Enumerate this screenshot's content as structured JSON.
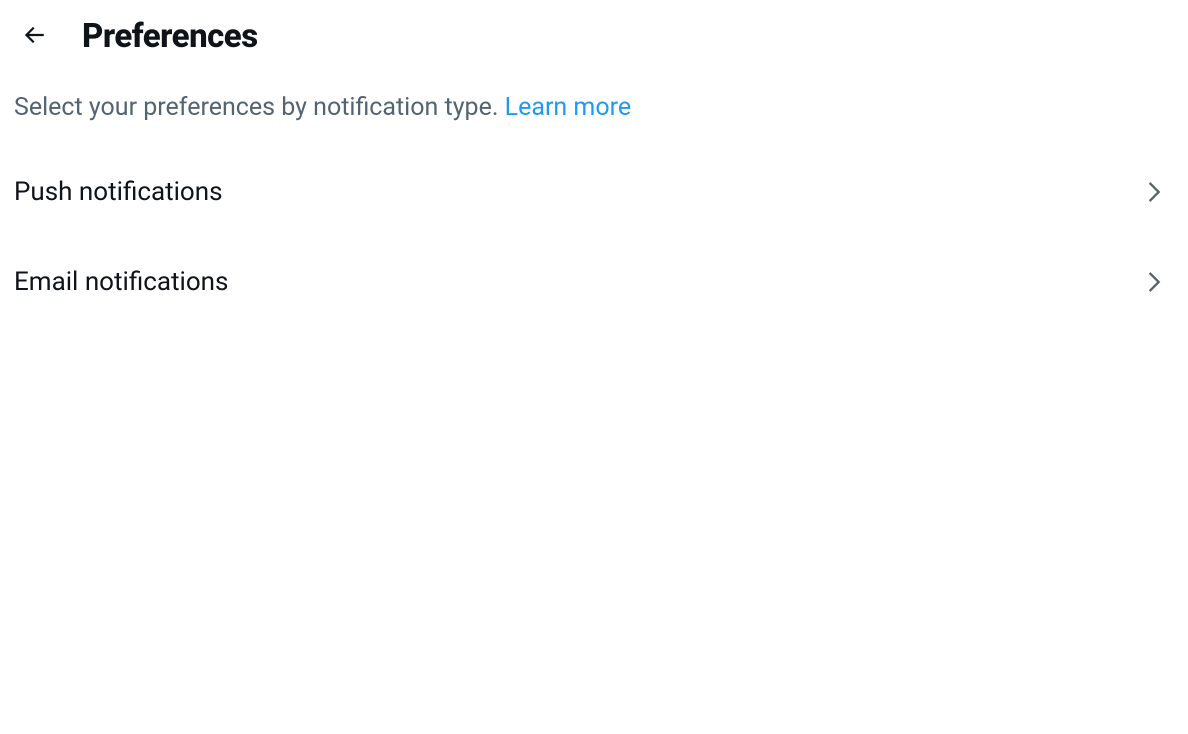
{
  "header": {
    "title": "Preferences"
  },
  "description": {
    "text": "Select your preferences by notification type. ",
    "learn_more": "Learn more"
  },
  "items": [
    {
      "label": "Push notifications"
    },
    {
      "label": "Email notifications"
    }
  ]
}
